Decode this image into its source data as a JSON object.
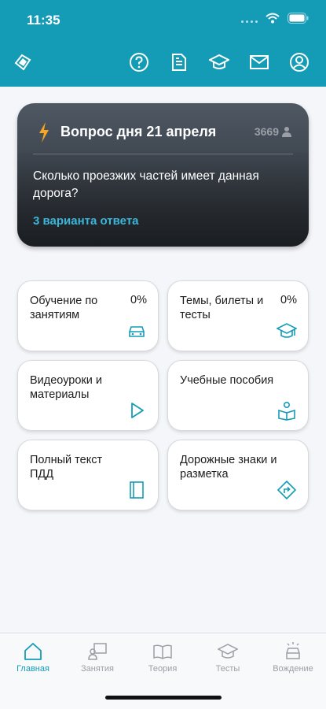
{
  "status_bar": {
    "time": "11:35"
  },
  "header": {
    "icons": [
      "logo-icon",
      "help-icon",
      "document-icon",
      "graduation-cap-icon",
      "mail-icon",
      "profile-icon"
    ]
  },
  "question_of_day": {
    "title": "Вопрос дня 21 апреля",
    "count": "3669",
    "question": "Сколько проезжих частей имеет данная дорога?",
    "answers": "3 варианта ответа"
  },
  "cards": [
    {
      "label": "Обучение по занятиям",
      "percent": "0%",
      "icon": "car-icon"
    },
    {
      "label": "Темы, билеты и тесты",
      "percent": "0%",
      "icon": "graduation-cap-icon"
    },
    {
      "label": "Видеоуроки и материалы",
      "icon": "play-icon"
    },
    {
      "label": "Учебные пособия",
      "icon": "reader-icon"
    },
    {
      "label": "Полный текст ПДД",
      "icon": "book-icon"
    },
    {
      "label": "Дорожные знаки и разметка",
      "icon": "road-sign-icon"
    }
  ],
  "tabbar": {
    "tabs": [
      {
        "label": "Главная",
        "active": true
      },
      {
        "label": "Занятия"
      },
      {
        "label": "Теория"
      },
      {
        "label": "Тесты"
      },
      {
        "label": "Вождение"
      }
    ]
  },
  "colors": {
    "accent": "#149cb6",
    "link": "#3ab7d9",
    "inactive": "#9aa0a6"
  }
}
